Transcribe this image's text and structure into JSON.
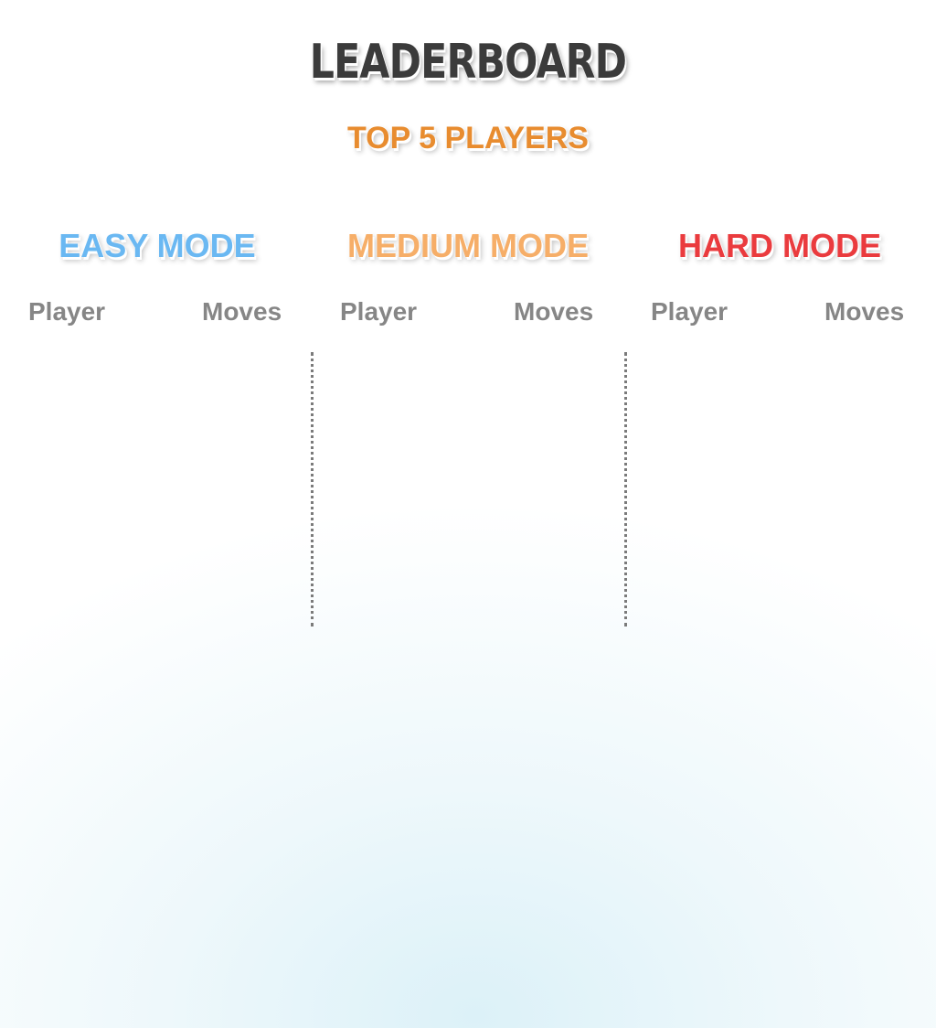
{
  "header": {
    "title": "LEADERBOARD",
    "subtitle": "TOP 5 PLAYERS"
  },
  "modes": [
    {
      "title": "EASY MODE",
      "player_header": "Player",
      "moves_header": "Moves",
      "color": "#6ab8f2"
    },
    {
      "title": "MEDIUM MODE",
      "player_header": "Player",
      "moves_header": "Moves",
      "color": "#f6ae68"
    },
    {
      "title": "HARD MODE",
      "player_header": "Player",
      "moves_header": "Moves",
      "color": "#ea3b3e"
    }
  ],
  "colors": {
    "title": "#3b3b3b",
    "subtitle": "#e88c2f",
    "column_header": "#868686"
  }
}
